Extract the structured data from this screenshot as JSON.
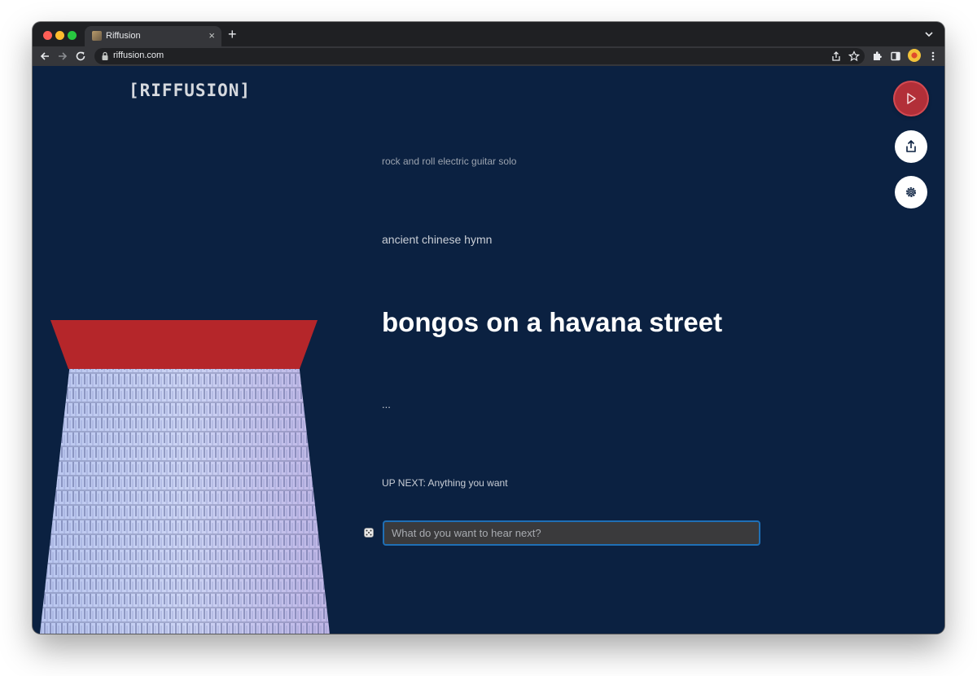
{
  "browser": {
    "tab_title": "Riffusion",
    "tab_close": "×",
    "new_tab": "+",
    "url": "riffusion.com"
  },
  "app": {
    "logo": "[RIFFUSION]",
    "prompts": {
      "previous_2": "rock and roll electric guitar solo",
      "previous_1": "ancient chinese hymn",
      "current": "bongos on a havana street",
      "next": "..."
    },
    "up_next": "UP NEXT: Anything you want",
    "input_placeholder": "What do you want to hear next?",
    "input_value": ""
  },
  "colors": {
    "background": "#0b2141",
    "play_button": "#b22f38",
    "input_border": "#1f6fb5",
    "spectrogram_cap": "#b5262a"
  },
  "icons": {
    "play": "play-icon",
    "share": "share-icon",
    "settings": "gear-icon",
    "dice": "dice-icon"
  }
}
